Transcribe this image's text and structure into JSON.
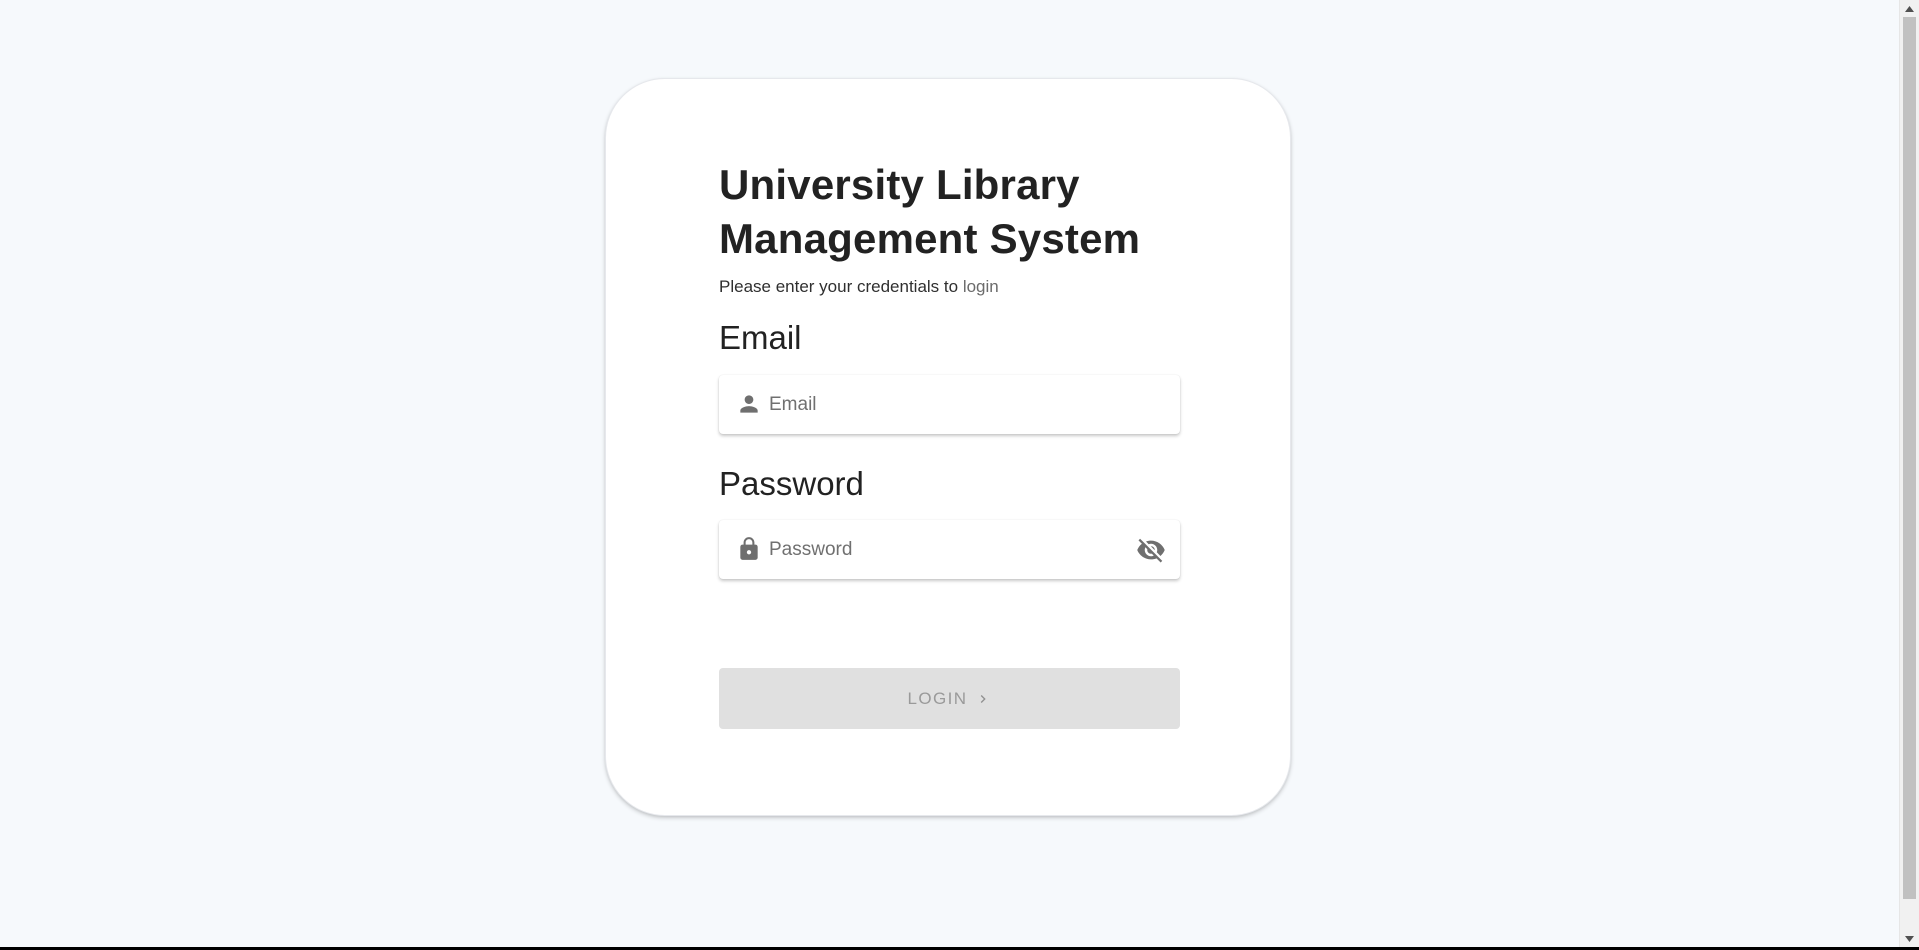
{
  "login_card": {
    "title": "University Library Management System",
    "subtitle_prefix": "Please enter your credentials to ",
    "subtitle_link": "login",
    "email": {
      "label": "Email",
      "placeholder": "Email",
      "value": "",
      "icon": "person-icon"
    },
    "password": {
      "label": "Password",
      "placeholder": "Password",
      "value": "",
      "icon": "lock-icon",
      "toggle_icon": "eye-off-icon"
    },
    "login_button": {
      "label": "LOGIN",
      "icon": "chevron-right-icon",
      "disabled": true
    }
  },
  "colors": {
    "page_background": "#f6f9fc",
    "card_background": "#ffffff",
    "text_primary": "#222222",
    "button_disabled_bg": "#e0e0e0",
    "button_disabled_text": "#9a9a9a",
    "icon_gray": "#6f6f6f"
  }
}
